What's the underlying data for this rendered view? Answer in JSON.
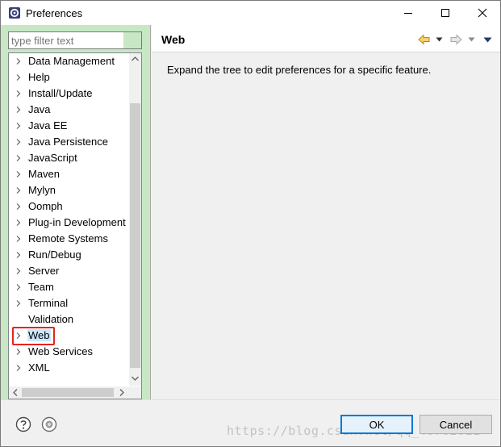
{
  "window": {
    "title": "Preferences",
    "icons": {
      "app": "eclipse-gear-icon",
      "minimize": "minimize-icon",
      "maximize": "maximize-icon",
      "close": "close-icon"
    }
  },
  "filter": {
    "placeholder": "type filter text",
    "value": ""
  },
  "tree": {
    "items": [
      {
        "label": "Data Management",
        "expandable": true,
        "selected": false
      },
      {
        "label": "Help",
        "expandable": true,
        "selected": false
      },
      {
        "label": "Install/Update",
        "expandable": true,
        "selected": false
      },
      {
        "label": "Java",
        "expandable": true,
        "selected": false
      },
      {
        "label": "Java EE",
        "expandable": true,
        "selected": false
      },
      {
        "label": "Java Persistence",
        "expandable": true,
        "selected": false
      },
      {
        "label": "JavaScript",
        "expandable": true,
        "selected": false
      },
      {
        "label": "Maven",
        "expandable": true,
        "selected": false
      },
      {
        "label": "Mylyn",
        "expandable": true,
        "selected": false
      },
      {
        "label": "Oomph",
        "expandable": true,
        "selected": false
      },
      {
        "label": "Plug-in Development",
        "expandable": true,
        "selected": false
      },
      {
        "label": "Remote Systems",
        "expandable": true,
        "selected": false
      },
      {
        "label": "Run/Debug",
        "expandable": true,
        "selected": false
      },
      {
        "label": "Server",
        "expandable": true,
        "selected": false
      },
      {
        "label": "Team",
        "expandable": true,
        "selected": false
      },
      {
        "label": "Terminal",
        "expandable": true,
        "selected": false
      },
      {
        "label": "Validation",
        "expandable": false,
        "selected": false
      },
      {
        "label": "Web",
        "expandable": true,
        "selected": true
      },
      {
        "label": "Web Services",
        "expandable": true,
        "selected": false
      },
      {
        "label": "XML",
        "expandable": true,
        "selected": false
      }
    ],
    "highlight_color": "#e8231b",
    "selection_color": "#cce8ff"
  },
  "page": {
    "title": "Web",
    "description": "Expand the tree to edit preferences for a specific feature.",
    "nav_icons": [
      "back-arrow-icon",
      "back-dropdown-icon",
      "forward-arrow-icon",
      "forward-dropdown-icon",
      "view-menu-icon"
    ]
  },
  "buttons": {
    "ok": "OK",
    "cancel": "Cancel",
    "help_icon": "help-icon",
    "import_icon": "import-export-icon"
  },
  "watermark": "https://blog.csdn.net/qq_40762011",
  "colors": {
    "tree_panel_bg": "#c7e7c5",
    "accent": "#0078d7"
  }
}
